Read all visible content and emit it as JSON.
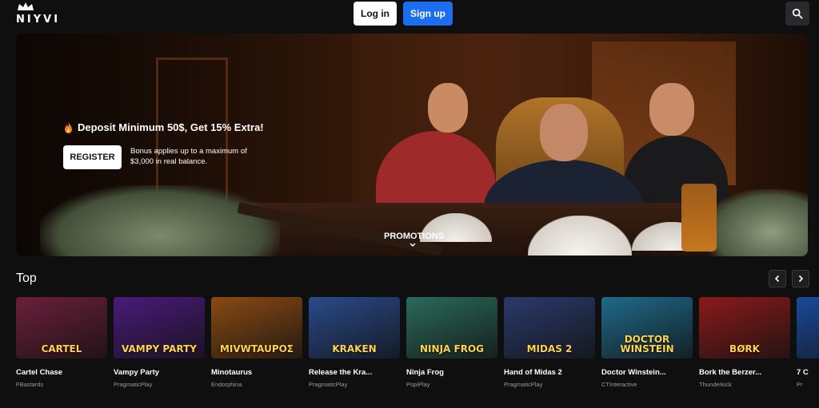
{
  "header": {
    "logo_text": "NIYVI",
    "login_label": "Log in",
    "signup_label": "Sign up",
    "search_icon": "search-icon"
  },
  "banner": {
    "headline": "Deposit Minimum 50$, Get 15% Extra!",
    "register_label": "REGISTER",
    "note": "Bonus applies up to a maximum of $3,000 in real balance.",
    "promotions_label": "PROMOTIONS"
  },
  "top": {
    "title": "Top",
    "games": [
      {
        "name": "Cartel Chase",
        "provider": "FBastards",
        "logo": "CARTEL",
        "color": "#6b1f3a"
      },
      {
        "name": "Vampy Party",
        "provider": "PragmaticPlay",
        "logo": "VAMPY PARTY",
        "color": "#4a1a7a"
      },
      {
        "name": "Minotaurus",
        "provider": "Endorphina",
        "logo": "MIVWTAUPOΣ",
        "color": "#8a4a12"
      },
      {
        "name": "Release the Kra...",
        "provider": "PragmaticPlay",
        "logo": "KRAKEN",
        "color": "#2a4a8a"
      },
      {
        "name": "Ninja Frog",
        "provider": "PopiPlay",
        "logo": "NINJA FROG",
        "color": "#2a6a5a"
      },
      {
        "name": "Hand of Midas 2",
        "provider": "PragmaticPlay",
        "logo": "MIDAS 2",
        "color": "#2a3a6a"
      },
      {
        "name": "Doctor Winstein...",
        "provider": "CTInteractive",
        "logo": "DOCTOR WINSTEIN",
        "color": "#1f6a8a"
      },
      {
        "name": "Bork the Berzer...",
        "provider": "Thunderkick",
        "logo": "BØRK",
        "color": "#8a1a1a"
      },
      {
        "name": "7 C",
        "provider": "Pr",
        "logo": "",
        "color": "#1a4a9a"
      }
    ]
  },
  "colors": {
    "accent": "#1c6df0",
    "background": "#0f0f10"
  }
}
